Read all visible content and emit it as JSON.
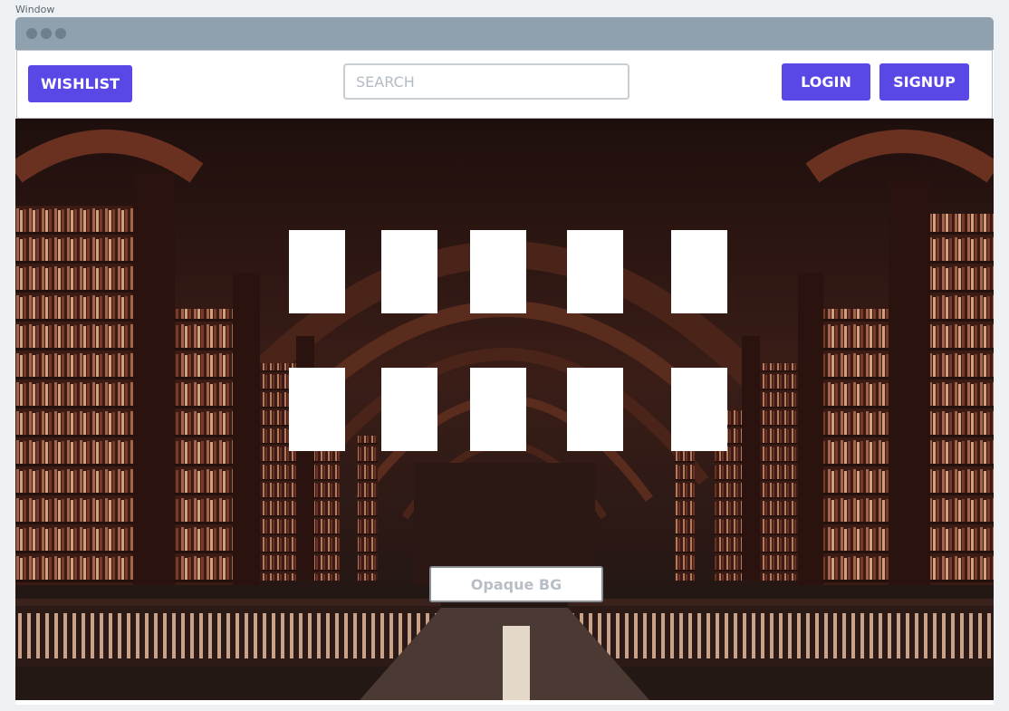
{
  "window": {
    "caption": "Window"
  },
  "navbar": {
    "wishlist_label": "WISHLIST",
    "search_placeholder": "SEARCH",
    "search_value": "",
    "login_label": "LOGIN",
    "signup_label": "SIGNUP"
  },
  "hero": {
    "background": "library hall photo",
    "grid": {
      "rows": 2,
      "columns": 5
    },
    "opaque_button_label": "Opaque BG"
  },
  "colors": {
    "accent": "#5a48e6",
    "titlebar": "#8fa0ae",
    "page_bg": "#eef1f4"
  }
}
